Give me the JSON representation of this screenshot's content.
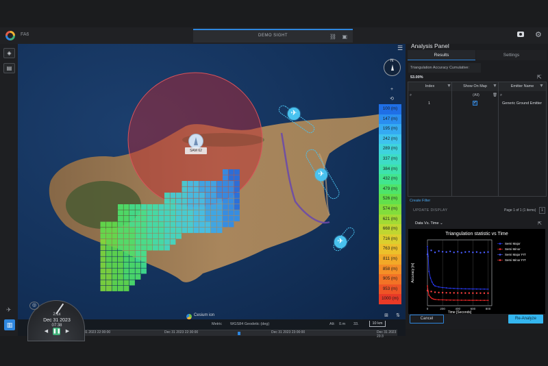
{
  "app": {
    "label": "FA6",
    "scene_title": "DEMO SIGHT"
  },
  "map": {
    "sam_label": "SAM 62",
    "compass_label": "N",
    "legend": [
      {
        "label": "100 (m)",
        "color": "#1f6fe6"
      },
      {
        "label": "147 (m)",
        "color": "#2a8ef0"
      },
      {
        "label": "195 (m)",
        "color": "#35aaf2"
      },
      {
        "label": "242 (m)",
        "color": "#3fc3ee"
      },
      {
        "label": "289 (m)",
        "color": "#3fd3dd"
      },
      {
        "label": "337 (m)",
        "color": "#3edcc6"
      },
      {
        "label": "384 (m)",
        "color": "#3ee2ad"
      },
      {
        "label": "432 (m)",
        "color": "#42e58f"
      },
      {
        "label": "479 (m)",
        "color": "#4ee46b"
      },
      {
        "label": "526 (m)",
        "color": "#62e04c"
      },
      {
        "label": "574 (m)",
        "color": "#82dd3c"
      },
      {
        "label": "621 (m)",
        "color": "#a2da35"
      },
      {
        "label": "668 (m)",
        "color": "#c0d631"
      },
      {
        "label": "716 (m)",
        "color": "#dbcf2e"
      },
      {
        "label": "763 (m)",
        "color": "#ecc02b"
      },
      {
        "label": "811 (m)",
        "color": "#f2a928"
      },
      {
        "label": "858 (m)",
        "color": "#f48f27"
      },
      {
        "label": "905 (m)",
        "color": "#f27326"
      },
      {
        "label": "953 (m)",
        "color": "#ee5526"
      },
      {
        "label": "1000 (m)",
        "color": "#e83a27"
      }
    ],
    "bottom": {
      "projection": "Metric",
      "datum": "WGS84 Geodetic (deg)",
      "alt_label": "Alt:",
      "alt_value": "0.m",
      "lon": "33.",
      "scale": "10 km"
    },
    "timeline": {
      "labels": [
        "Dec 31 2023 22:00:00",
        "Dec 31 2023 22:30:00",
        "Dec 31 2023 23:00:00",
        "Dec 31 2023 23:3"
      ]
    },
    "attribution": "Cesium ion"
  },
  "clock": {
    "speed": "2.1x",
    "date": "Dec 31 2023",
    "time": "07:38"
  },
  "panel": {
    "title": "Analysis Panel",
    "tabs": {
      "results": "Results",
      "settings": "Settings"
    },
    "triangulation_label": "Triangulation Accuracy Cumulative:",
    "triangulation_value": "53.00%",
    "table": {
      "headers": [
        "Index",
        "Show On Map",
        "Emitter Name"
      ],
      "filter_row": {
        "show": "(All)"
      },
      "rows": [
        {
          "index": "1",
          "show_on_map": "✓",
          "emitter": "Generic Ground Emitter"
        }
      ]
    },
    "create_filter": "Create Filter",
    "update_display": "UPDATE DISPLAY",
    "pager": "Page 1 of 1 (1 items)",
    "pager_page": "1",
    "chart_select": "Data Vs. Time",
    "cancel": "Cancel",
    "reanalyze": "Re-Analyze"
  },
  "chart_data": {
    "type": "scatter",
    "title": "Triangulation statistic vs Time",
    "xlabel": "Time [Seconds]",
    "ylabel": "Accuracy [m]",
    "xlim": [
      0,
      850
    ],
    "ylim": [
      0,
      1000
    ],
    "x_ticks": [
      0,
      200,
      400,
      600,
      800
    ],
    "grid": true,
    "legend_position": "top-right",
    "series": [
      {
        "name": "Semi Major",
        "color": "#2a3cff",
        "kind": "line",
        "x": [
          0,
          10,
          20,
          40,
          60,
          80,
          100,
          150,
          200,
          250,
          300,
          350,
          400,
          450,
          500,
          550,
          600,
          650,
          700,
          750,
          800
        ],
        "y": [
          900,
          750,
          520,
          420,
          360,
          320,
          300,
          285,
          275,
          270,
          265,
          262,
          260,
          258,
          256,
          255,
          254,
          253,
          252,
          252,
          251
        ]
      },
      {
        "name": "Semi Minor",
        "color": "#ff2a2a",
        "kind": "line",
        "x": [
          0,
          10,
          20,
          40,
          60,
          80,
          100,
          150,
          200,
          250,
          300,
          350,
          400,
          450,
          500,
          550,
          600,
          650,
          700,
          750,
          800
        ],
        "y": [
          300,
          220,
          160,
          130,
          110,
          100,
          95,
          90,
          88,
          86,
          85,
          84,
          84,
          83,
          83,
          82,
          82,
          82,
          81,
          81,
          81
        ]
      },
      {
        "name": "Semi Major FIT",
        "color": "#4a5cff",
        "kind": "marker",
        "x": [
          0,
          50,
          100,
          150,
          200,
          250,
          300,
          350,
          400,
          450,
          500,
          550,
          600,
          650,
          700,
          750,
          800
        ],
        "y": [
          780,
          840,
          810,
          830,
          820,
          815,
          825,
          810,
          820,
          805,
          815,
          820,
          810,
          815,
          805,
          810,
          815
        ]
      },
      {
        "name": "Semi Minor FIT",
        "color": "#ff4040",
        "kind": "marker",
        "x": [
          0,
          50,
          100,
          150,
          200,
          250,
          300,
          350,
          400,
          450,
          500,
          550,
          600,
          650,
          700,
          750,
          800
        ],
        "y": [
          230,
          215,
          205,
          200,
          198,
          196,
          195,
          194,
          193,
          193,
          192,
          192,
          191,
          191,
          191,
          190,
          190
        ]
      }
    ]
  }
}
